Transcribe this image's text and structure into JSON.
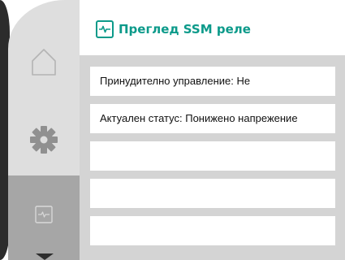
{
  "header": {
    "title": "Преглед SSM реле",
    "icon": "monitor-icon",
    "accent_color": "#0c9a8a"
  },
  "sidebar": {
    "items": [
      {
        "name": "home",
        "icon": "home-icon",
        "selected": false
      },
      {
        "name": "settings",
        "icon": "gear-icon",
        "selected": false
      },
      {
        "name": "monitor",
        "icon": "monitor-icon",
        "selected": true
      }
    ],
    "more_indicator": "chevron-down-icon"
  },
  "list": {
    "rows": [
      {
        "text": "Принудително управление: Не"
      },
      {
        "text": "Актуален статус: Понижено напрежение"
      },
      {
        "text": ""
      },
      {
        "text": ""
      },
      {
        "text": ""
      }
    ]
  }
}
